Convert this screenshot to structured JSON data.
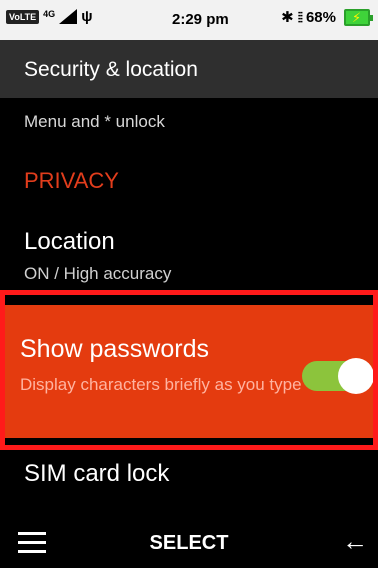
{
  "status_bar": {
    "volte": "VoLTE",
    "network": "4G",
    "time": "2:29 pm",
    "battery": "68%",
    "icons": [
      "signal-icon",
      "usb-icon",
      "bluetooth-icon",
      "vibrate-icon",
      "battery-charging-icon"
    ]
  },
  "app_bar": {
    "title": "Security & location"
  },
  "list": {
    "menu_unlock": "Menu and * unlock",
    "privacy_header": "PRIVACY",
    "location": {
      "title": "Location",
      "summary": "ON / High accuracy"
    },
    "show_passwords": {
      "title": "Show passwords",
      "summary": "Display characters briefly as you type",
      "toggle_on": true
    },
    "sim_card_lock": "SIM card lock"
  },
  "softkeys": {
    "center": "SELECT",
    "left_icon": "menu-icon",
    "right_icon": "back-arrow-icon"
  },
  "colors": {
    "accent": "#e43b0f",
    "toggle_on": "#8cc43c",
    "highlight_border": "#ff1a1a",
    "app_bar": "#2f2f2f"
  }
}
